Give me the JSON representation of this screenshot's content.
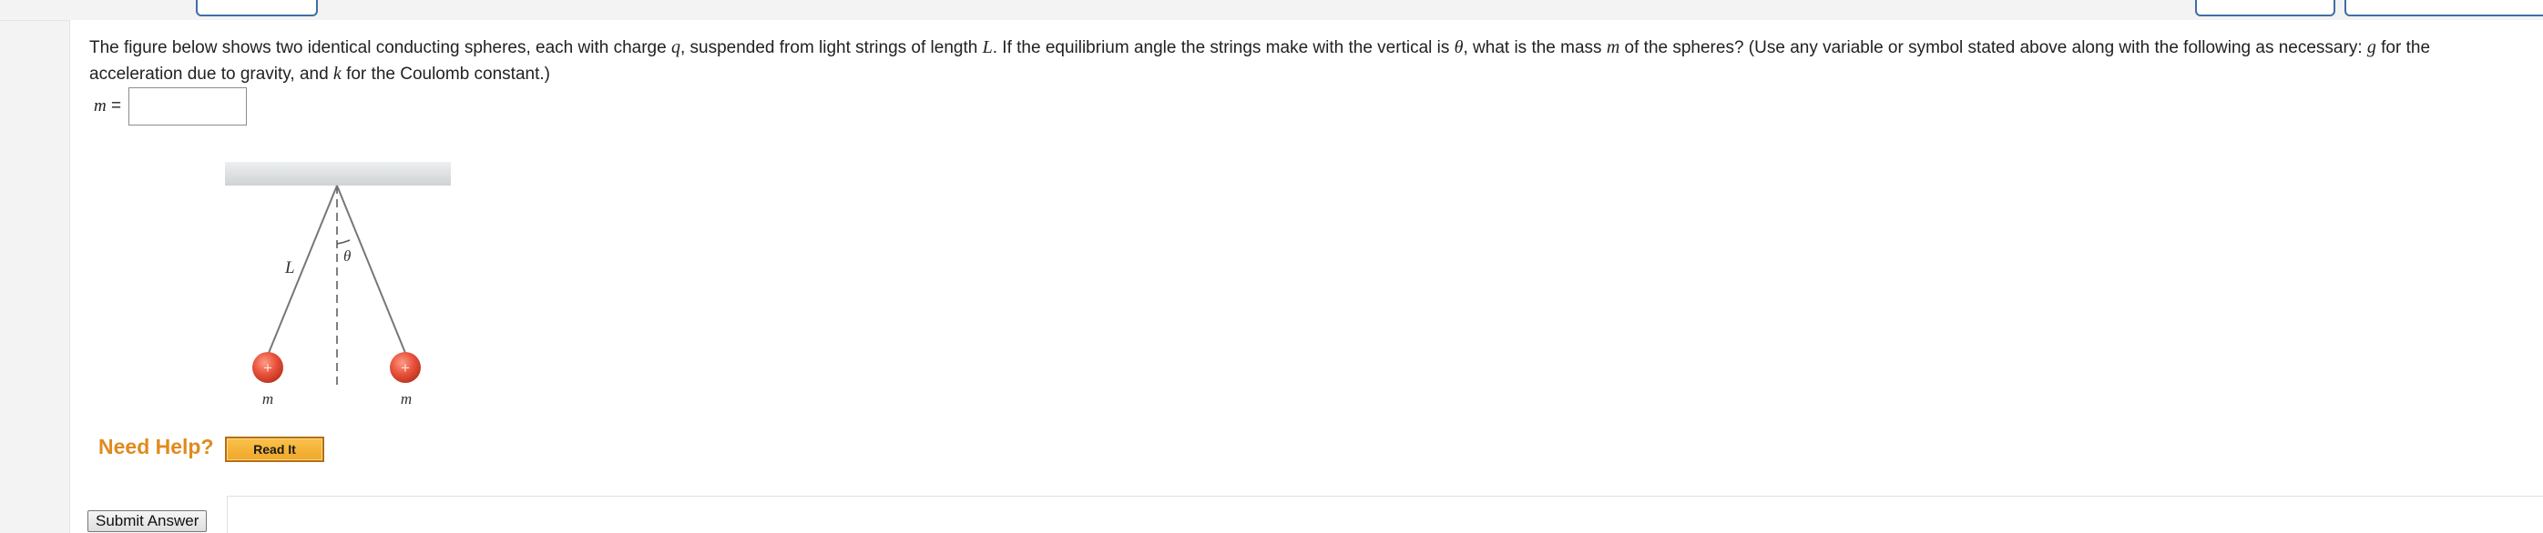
{
  "question": {
    "line1_parts": [
      "The figure below shows two identical conducting spheres, each with charge ",
      "q",
      ", suspended from light strings of length ",
      "L",
      ". If the equilibrium angle the strings make with the vertical is ",
      "θ",
      ", what is the mass ",
      "m",
      " of the spheres? (Use any variable or symbol stated above along with the following as necessary: ",
      "g",
      " for the"
    ],
    "line2_parts": [
      "acceleration due to gravity, and ",
      "k",
      " for the Coulomb constant.)"
    ]
  },
  "answer": {
    "variable": "m",
    "equals": "=",
    "value": "",
    "placeholder": ""
  },
  "figure": {
    "length_label": "L",
    "angle_label": "θ",
    "left_mass_label": "m",
    "right_mass_label": "m",
    "charge_symbol": "+",
    "sphere_color": "#e8503a",
    "ceiling_color": "#d9dcdc"
  },
  "help": {
    "label": "Need Help?",
    "read_it_label": "Read It"
  },
  "actions": {
    "submit_label": "Submit Answer"
  },
  "colors": {
    "need_help": "#e08a1e",
    "top_button_border": "#3f6ea6"
  }
}
